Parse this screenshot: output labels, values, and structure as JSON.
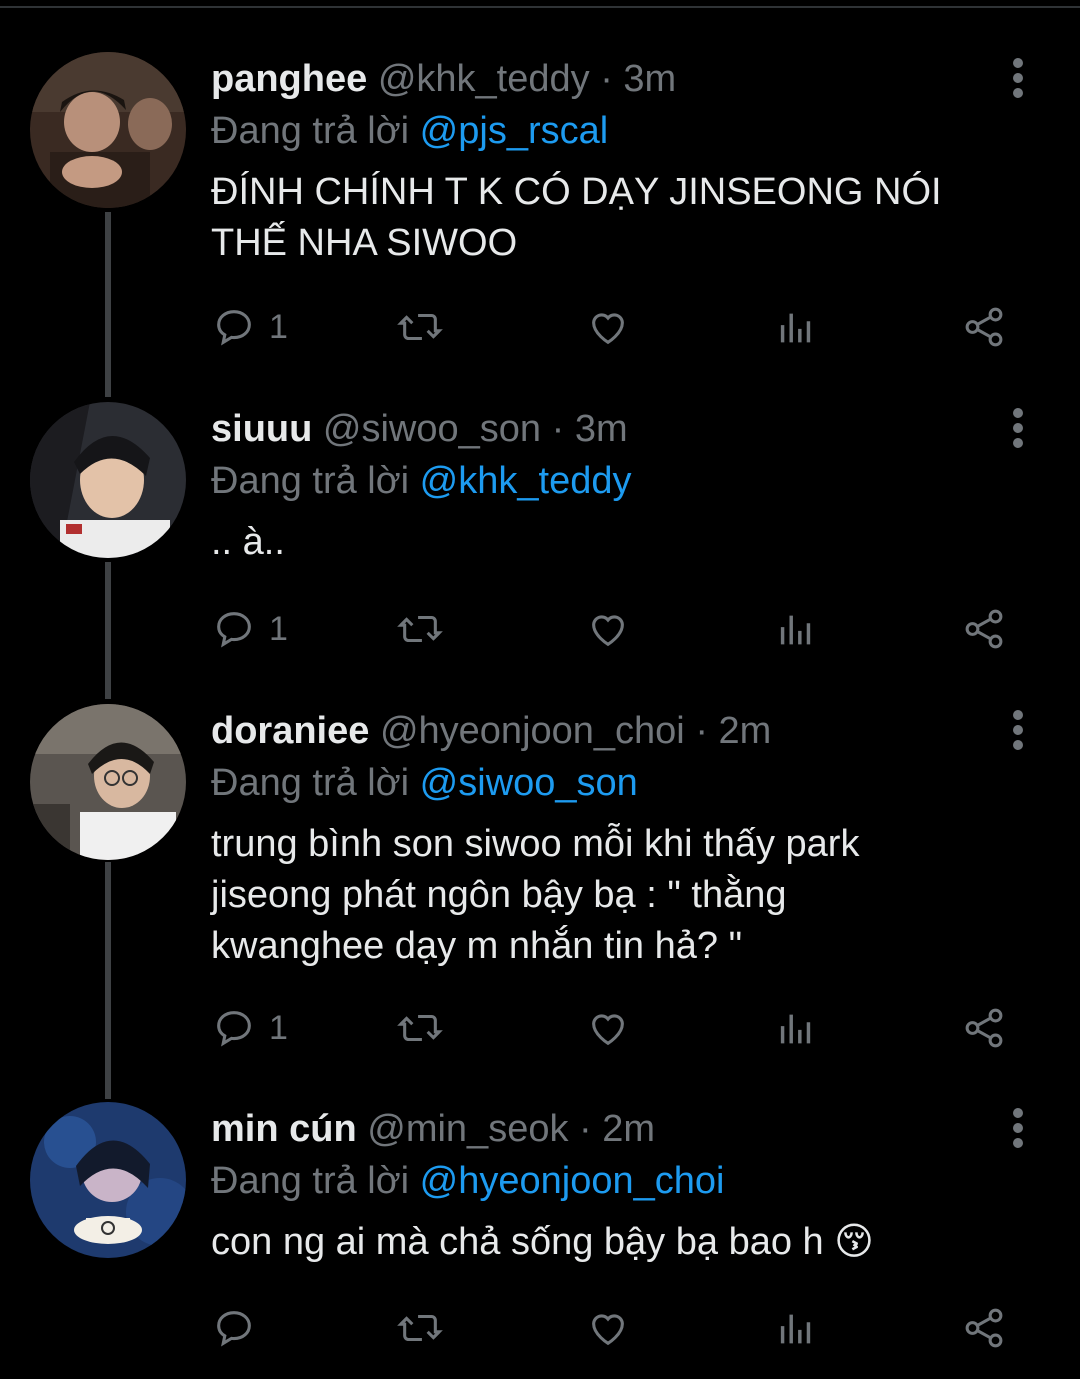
{
  "tweets": [
    {
      "name": "panghee",
      "handle": "@khk_teddy",
      "separator": "·",
      "time": "3m",
      "reply_prefix": "Đang trả lời",
      "reply_to": "@pjs_rscal",
      "text_lines": [
        "ĐÍNH CHÍNH T K CÓ DẠY JINSEONG NÓI",
        "THẾ NHA SIWOO"
      ],
      "reply_count": "1"
    },
    {
      "name": "siuuu",
      "handle": "@siwoo_son",
      "separator": "·",
      "time": "3m",
      "reply_prefix": "Đang trả lời",
      "reply_to": "@khk_teddy",
      "text_lines": [
        ".. à.."
      ],
      "reply_count": "1"
    },
    {
      "name": "doraniee",
      "handle": "@hyeonjoon_choi",
      "separator": "·",
      "time": "2m",
      "reply_prefix": "Đang trả lời",
      "reply_to": "@siwoo_son",
      "text_lines": [
        "trung bình son siwoo mỗi khi thấy park",
        "jiseong phát ngôn bậy bạ : \" thằng",
        "kwanghee dạy m nhắn tin hả? \""
      ],
      "reply_count": "1"
    },
    {
      "name": "min cún",
      "handle": "@min_seok",
      "separator": "·",
      "time": "2m",
      "reply_prefix": "Đang trả lời",
      "reply_to": "@hyeonjoon_choi",
      "text_lines": [
        "con ng ai mà chả sống bậy bạ bao h 😚"
      ],
      "reply_count": ""
    }
  ],
  "icons": {
    "reply": "reply-icon",
    "retweet": "retweet-icon",
    "like": "like-icon",
    "views": "views-icon",
    "share": "share-icon",
    "more": "more-options-icon"
  },
  "colors": {
    "background": "#000000",
    "text": "#e7e9ea",
    "secondary": "#71767b",
    "accent": "#1d9bf0"
  }
}
